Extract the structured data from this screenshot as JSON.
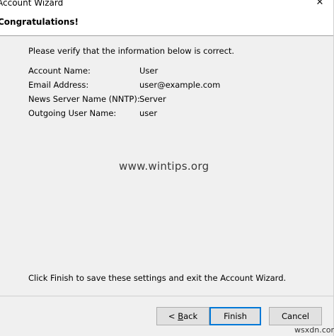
{
  "window": {
    "title": "Account Wizard",
    "close_glyph": "✕"
  },
  "header": {
    "title": "Congratulations!"
  },
  "content": {
    "intro": "Please verify that the information below is correct.",
    "fields": [
      {
        "label": "Account Name:",
        "value": "User"
      },
      {
        "label": "Email Address:",
        "value": "user@example.com"
      },
      {
        "label": "News Server Name (NNTP):",
        "value": "Server"
      },
      {
        "label": "Outgoing User Name:",
        "value": "user"
      }
    ],
    "footer_note": "Click Finish to save these settings and exit the Account Wizard."
  },
  "watermark": "www.wintips.org",
  "buttons": {
    "back_prefix": "< ",
    "back_accel": "B",
    "back_rest": "ack",
    "finish": "Finish",
    "cancel": "Cancel"
  },
  "site_mark": "wsxdn.com",
  "colors": {
    "default_button_border": "#0078d7",
    "dialog_background": "#f0f0f0"
  }
}
